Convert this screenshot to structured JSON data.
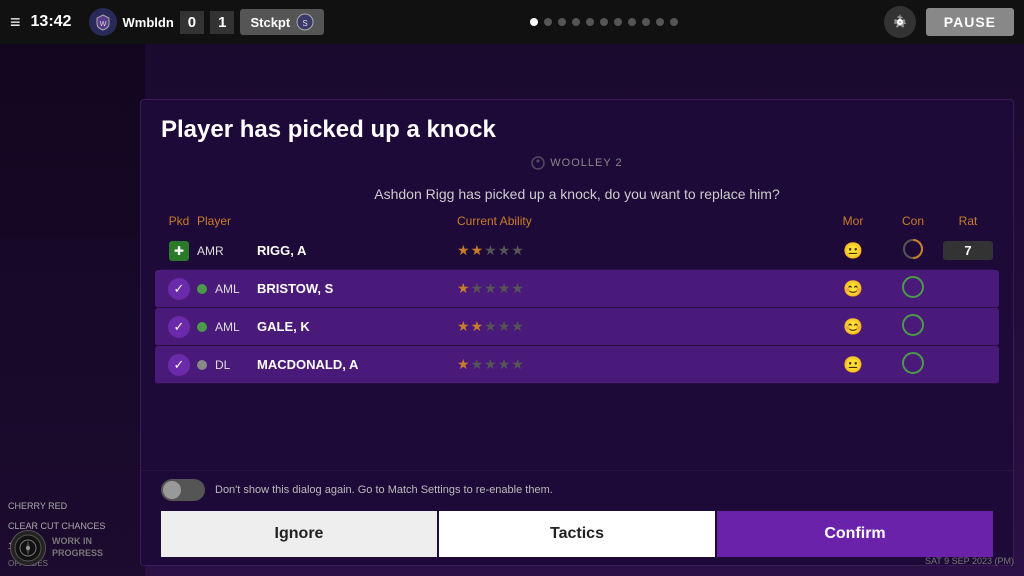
{
  "topbar": {
    "menu_icon": "≡",
    "time": "13:42",
    "team1": {
      "name": "Wmbldn",
      "badge": "🛡"
    },
    "score1": "0",
    "score2": "1",
    "team2": {
      "name": "Stckpt",
      "badge": "⚙"
    },
    "dots": [
      true,
      false,
      false,
      false,
      false,
      false,
      false,
      false,
      false,
      false,
      false
    ],
    "gear_icon": "⚙",
    "pause_label": "PAUSE"
  },
  "woolley": "WOOLLEY 2",
  "dialog": {
    "title": "Player has picked up a knock",
    "subtitle": "Ashdon Rigg has picked up a knock, do you want to replace him?",
    "table": {
      "headers": {
        "pkd": "Pkd",
        "pos": "Player",
        "player": "",
        "ability": "Current Ability",
        "mor": "Mor",
        "con": "Con",
        "rat": "Rat"
      },
      "rows": [
        {
          "pkd_type": "medical",
          "pos": "AMR",
          "player": "RIGG, A",
          "stars_filled": 2,
          "stars_total": 5,
          "morale": "neutral",
          "con_type": "half",
          "rating": "7",
          "selected": false,
          "highlighted": false,
          "fitness": null
        },
        {
          "pkd_type": "check",
          "pos": "AML",
          "player": "BRISTOW, S",
          "stars_filled": 1,
          "stars_total": 5,
          "morale": "happy",
          "con_type": "green",
          "rating": "",
          "selected": true,
          "highlighted": false,
          "fitness": "green"
        },
        {
          "pkd_type": "check",
          "pos": "AML",
          "player": "GALE, K",
          "stars_filled": 2,
          "stars_total": 5,
          "morale": "happy",
          "con_type": "green",
          "rating": "",
          "selected": true,
          "highlighted": false,
          "fitness": "green"
        },
        {
          "pkd_type": "check",
          "pos": "DL",
          "player": "MACDONALD, A",
          "stars_filled": 1,
          "stars_total": 5,
          "morale": "neutral",
          "con_type": "green",
          "rating": "",
          "selected": true,
          "highlighted": false,
          "fitness": "gray"
        }
      ]
    },
    "dont_show_text": "Don't show this dialog again. Go to Match Settings to re-enable them.",
    "buttons": {
      "ignore": "Ignore",
      "tactics": "Tactics",
      "confirm": "Confirm"
    }
  },
  "sidebar": {
    "cherry_red": "Cherry Red",
    "clear_cut_label": "CLEAR CUT CHANCES",
    "offsides_label": "OFFSIDES",
    "clear_cut_val": "1",
    "offsides_val": ""
  },
  "wip": {
    "label": "WORK IN\nPROGRESS"
  },
  "bottom_right": "SAT 9 SEP 2023 (PM)"
}
